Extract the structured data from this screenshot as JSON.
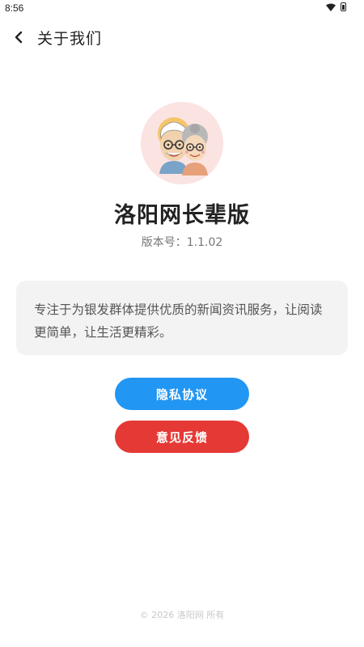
{
  "status_bar": {
    "time": "8:56",
    "wifi_icon": "wifi-icon",
    "battery_icon": "battery-icon"
  },
  "header": {
    "title": "关于我们",
    "back_icon": "chevron-left-icon"
  },
  "app": {
    "name": "洛阳网长辈版",
    "version": "版本号：1.1.02",
    "logo_icon": "elderly-couple-logo"
  },
  "description": "专注于为银发群体提供优质的新闻资讯服务，让阅读更简单，让生活更精彩。",
  "buttons": {
    "privacy": "隐私协议",
    "feedback": "意见反馈"
  },
  "footer": "© 2026 洛阳网 所有",
  "colors": {
    "primary": "#2196f3",
    "danger": "#e53935",
    "card_bg": "#f3f3f4",
    "avatar_bg": "#fbe3e1"
  }
}
